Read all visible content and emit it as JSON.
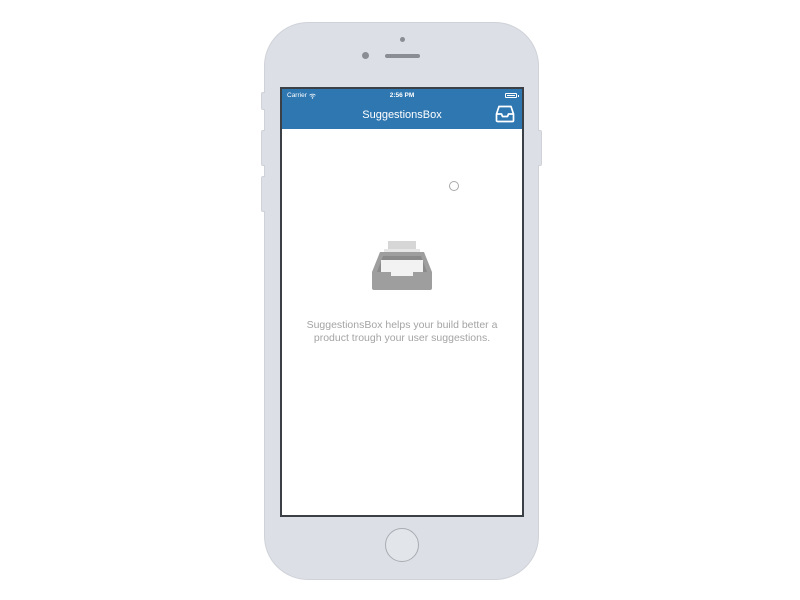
{
  "status_bar": {
    "carrier": "Carrier",
    "time": "2:56 PM",
    "wifi_icon": "wifi-icon",
    "battery_icon": "battery-icon"
  },
  "nav": {
    "title": "SuggestionsBox",
    "right_icon": "inbox-icon",
    "background_color": "#2f77b1"
  },
  "empty_state": {
    "icon": "inbox-tray-icon",
    "message": "SuggestionsBox helps your build better a product trough your user suggestions."
  },
  "device": {
    "frame_color": "#dcdfe5"
  }
}
